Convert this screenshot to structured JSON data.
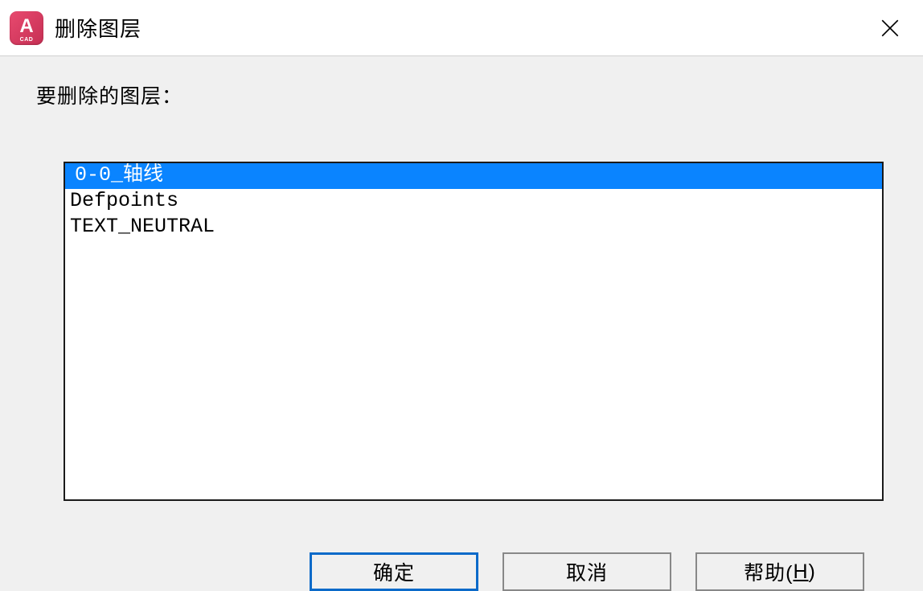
{
  "window": {
    "title": "删除图层",
    "app_icon_letter": "A",
    "app_icon_sub": "CAD"
  },
  "prompt": "要删除的图层：",
  "layers": [
    {
      "name": " 0-0_轴线",
      "selected": true
    },
    {
      "name": "Defpoints",
      "selected": false
    },
    {
      "name": "TEXT_NEUTRAL",
      "selected": false
    }
  ],
  "buttons": {
    "ok": "确定",
    "cancel": "取消",
    "help_prefix": "帮助(",
    "help_key": "H",
    "help_suffix": ")"
  }
}
